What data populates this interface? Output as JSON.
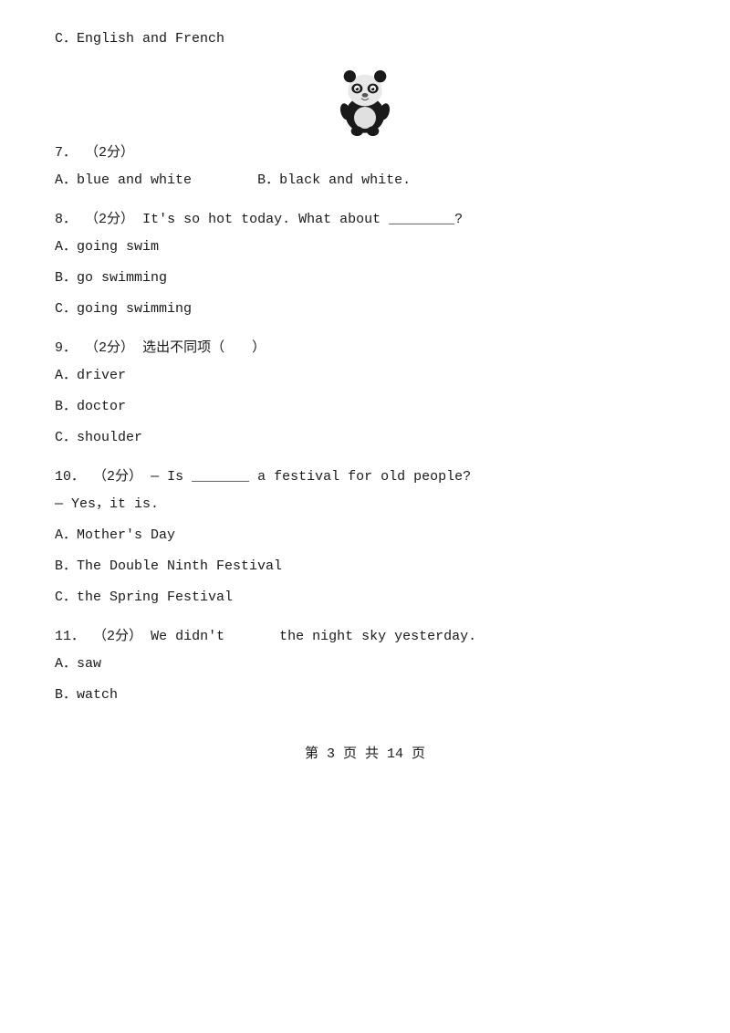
{
  "items": [
    {
      "id": "c_option_top",
      "text": "C．English and French"
    },
    {
      "id": "q7",
      "number": "7．",
      "points": "（2分）",
      "options": [
        {
          "label": "A",
          "text": "blue and white"
        },
        {
          "label": "B",
          "text": "black and white."
        }
      ]
    },
    {
      "id": "q8",
      "number": "8．",
      "points": "（2分）",
      "stem": "It's so hot today. What about ________?",
      "options": [
        {
          "label": "A",
          "text": "going swim"
        },
        {
          "label": "B",
          "text": "go swimming"
        },
        {
          "label": "C",
          "text": "going swimming"
        }
      ]
    },
    {
      "id": "q9",
      "number": "9．",
      "points": "（2分）",
      "stem": "选出不同项（　　）",
      "options": [
        {
          "label": "A",
          "text": "driver"
        },
        {
          "label": "B",
          "text": "doctor"
        },
        {
          "label": "C",
          "text": "shoulder"
        }
      ]
    },
    {
      "id": "q10",
      "number": "10．",
      "points": "（2分）",
      "stem": "— Is _______ a festival for old people?",
      "response": "— Yes，it is.",
      "options": [
        {
          "label": "A",
          "text": "Mother's Day"
        },
        {
          "label": "B",
          "text": "The Double Ninth Festival"
        },
        {
          "label": "C",
          "text": "the Spring Festival"
        }
      ]
    },
    {
      "id": "q11",
      "number": "11．",
      "points": "（2分）",
      "stem": "We didn't　　　　the night sky yesterday.",
      "options": [
        {
          "label": "A",
          "text": "saw"
        },
        {
          "label": "B",
          "text": "watch"
        }
      ]
    }
  ],
  "footer": {
    "page": "第 3 页 共 14 页"
  }
}
